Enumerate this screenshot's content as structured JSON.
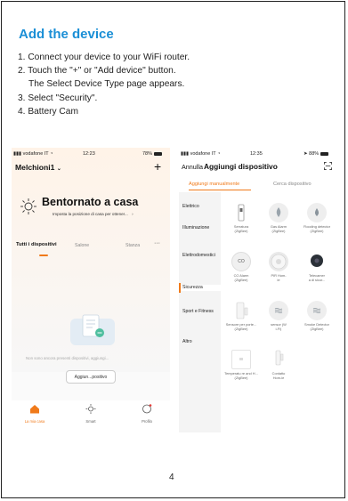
{
  "title": "Add the device",
  "steps": [
    "1. Connect your device to your WiFi router.",
    "2. Touch the \"+\" or \"Add device\" button.",
    "The Select Device Type page appears.",
    "3. Select \"Security\".",
    "4. Battery Cam"
  ],
  "phone1": {
    "carrier": "vodafone IT",
    "time": "12:23",
    "battery": "78%",
    "home_name": "Melchioni1",
    "welcome": "Bentornato a casa",
    "location_prompt": "Imposta la posizione di casa per ottener...",
    "tabs": [
      "Tutti i dispositivi",
      "Salone",
      "Stanza"
    ],
    "empty_text": "Non sono ancora presenti dispositivi, aggiungi...",
    "add_button": "Aggiun...positivo",
    "nav": [
      "La mia casa",
      "Smart",
      "Profilo"
    ]
  },
  "phone2": {
    "carrier": "vodafone IT",
    "time": "12:35",
    "battery": "88%",
    "cancel": "Annulla",
    "title": "Aggiungi dispositivo",
    "tabs": [
      "Aggiungi manualmente",
      "Cerca dispositivo"
    ],
    "categories": [
      "Elettrico",
      "Illuminazione",
      "Elettrodomestici",
      "Sicurezza",
      "Sport e Fitness",
      "Altro"
    ],
    "devices": [
      {
        "l1": "Serratura",
        "l2": "(ZigBee)"
      },
      {
        "l1": "Gas Alarm",
        "l2": "(ZigBee)"
      },
      {
        "l1": "Flooding detector",
        "l2": "(ZigBee)"
      },
      {
        "l1": "CO Alarm",
        "l2": "(ZigBee)"
      },
      {
        "l1": "PIR Hom-",
        "l2": "ie"
      },
      {
        "l1": "Telecamer",
        "l2": "a di sicur..."
      },
      {
        "l1": "Sensore per porte...",
        "l2": "(ZigBee)"
      },
      {
        "l1": "sensor (W",
        "l2": "i-Fi)"
      },
      {
        "l1": "Smoke Detector",
        "l2": "(ZigBee)"
      },
      {
        "l1": "Temperatu re and H...",
        "l2": "(ZigBee)"
      },
      {
        "l1": "Contatto",
        "l2": "Hom-ie"
      }
    ]
  },
  "page_number": "4",
  "colors": {
    "accent_blue": "#1b8fd6",
    "accent_orange": "#f07a1a"
  }
}
